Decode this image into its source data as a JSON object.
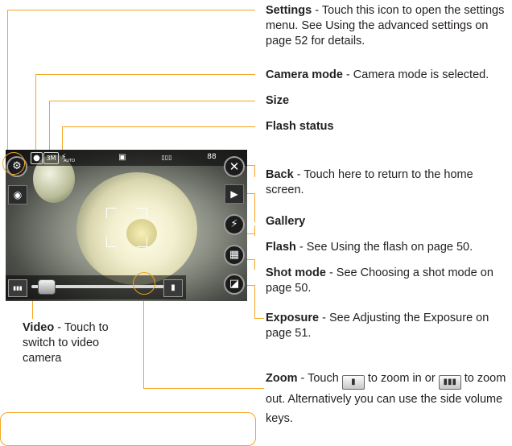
{
  "labels": {
    "settings": {
      "title": "Settings",
      "text": " - Touch this icon to open the settings menu. See Using the advanced settings on page 52 for details."
    },
    "camera_mode": {
      "title": "Camera mode",
      "text": " - Camera mode is selected."
    },
    "size": {
      "title": "Size"
    },
    "flash_status": {
      "title": "Flash status"
    },
    "back": {
      "title": "Back",
      "text": " - Touch here to return to the home screen."
    },
    "gallery": {
      "title": "Gallery"
    },
    "flash": {
      "title": "Flash",
      "text": " - See Using the flash on page 50."
    },
    "shot_mode": {
      "title": "Shot mode",
      "text": " - See Choosing a shot mode on page 50."
    },
    "exposure": {
      "title": "Exposure",
      "text": " - See Adjusting the Exposure on page 51."
    },
    "video": {
      "title": "Video",
      "text": " - Touch to switch to video camera"
    },
    "zoom": {
      "title": "Zoom",
      "text_a": " - Touch ",
      "text_b": " to zoom in or ",
      "text_c": " to zoom out. Alternatively you can use the side volume keys."
    }
  },
  "screen": {
    "top_icons": {
      "mode": "●",
      "size": "3M",
      "flash": "⚡",
      "flash_sub": "AUTO",
      "scene": "▣",
      "battery": "▯▯▯",
      "shots": "88"
    },
    "side_icons": {
      "back": "✕",
      "gallery": "▶",
      "flash": "⚡",
      "shot_mode": "▦",
      "exposure": "◪",
      "settings": "⚙",
      "video": "◉"
    },
    "zoom_icons": {
      "zoom_out": "▮▮▮",
      "zoom_in": "▮"
    },
    "zoom_level": 0.05
  },
  "colors": {
    "leader": "#f5a623",
    "accent_text": "#231f20"
  }
}
